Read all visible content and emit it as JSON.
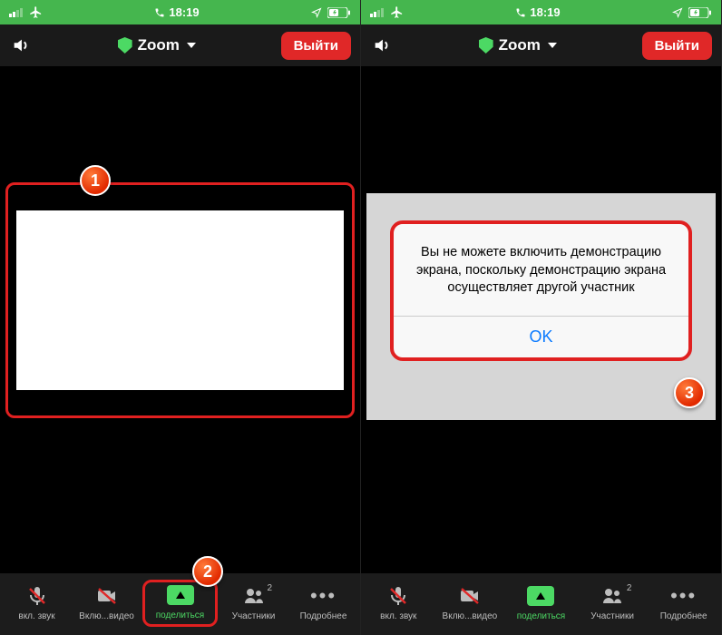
{
  "statusbar": {
    "time": "18:19",
    "icons": {
      "signal": "ıı..",
      "airplane": "airplane",
      "handset": "handset",
      "location": "location",
      "battery": "battery"
    }
  },
  "header": {
    "title": "Zoom",
    "leave_label": "Выйти"
  },
  "toolbar": {
    "audio": "вкл. звук",
    "video": "Вклю...видео",
    "share": "поделиться",
    "participants": "Участники",
    "participants_count": "2",
    "more": "Подробнее"
  },
  "dialog": {
    "message": "Вы не можете включить демонстрацию экрана, поскольку демонстрацию экрана осуществляет другой участник",
    "ok": "OK"
  },
  "callouts": {
    "c1": "1",
    "c2": "2",
    "c3": "3"
  }
}
